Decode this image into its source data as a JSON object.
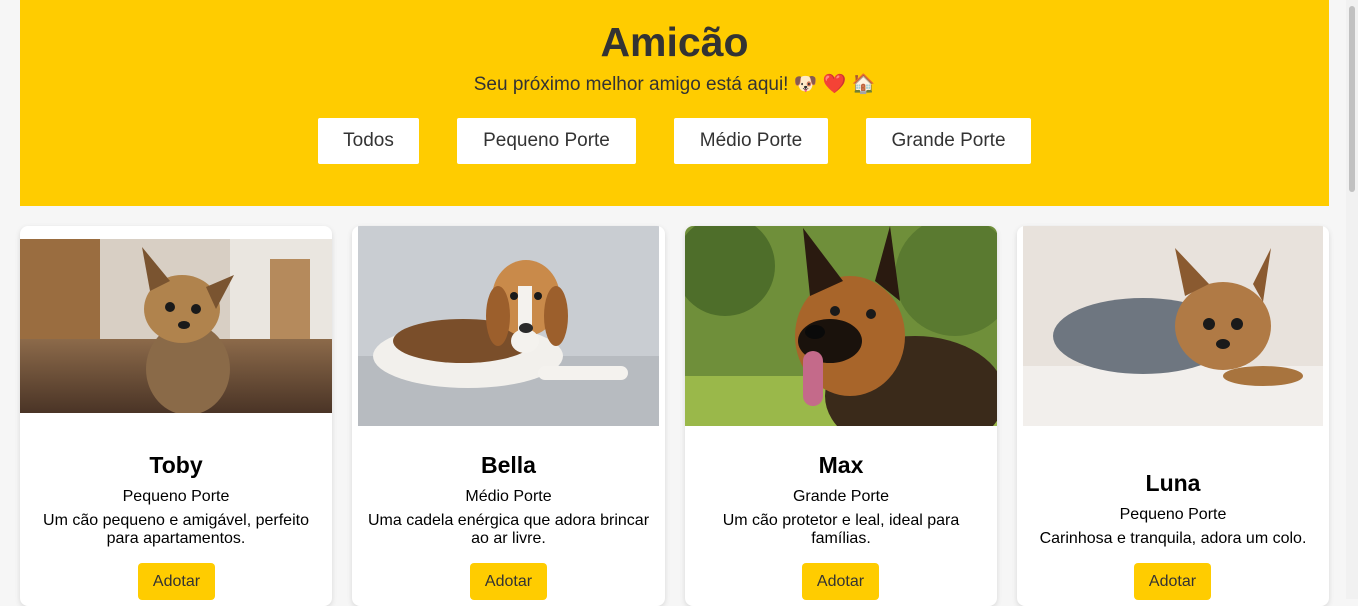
{
  "header": {
    "title": "Amicão",
    "subtitle": "Seu próximo melhor amigo está aqui! 🐶 ❤️ 🏠",
    "filters": [
      "Todos",
      "Pequeno Porte",
      "Médio Porte",
      "Grande Porte"
    ]
  },
  "dogs": [
    {
      "name": "Toby",
      "size": "Pequeno Porte",
      "description": "Um cão pequeno e amigável, perfeito para apartamentos.",
      "button": "Adotar",
      "photo": "yorkshire-terrier-photo"
    },
    {
      "name": "Bella",
      "size": "Médio Porte",
      "description": "Uma cadela enérgica que adora brincar ao ar livre.",
      "button": "Adotar",
      "photo": "beagle-photo"
    },
    {
      "name": "Max",
      "size": "Grande Porte",
      "description": "Um cão protetor e leal, ideal para famílias.",
      "button": "Adotar",
      "photo": "german-shepherd-photo"
    },
    {
      "name": "Luna",
      "size": "Pequeno Porte",
      "description": "Carinhosa e tranquila, adora um colo.",
      "button": "Adotar",
      "photo": "yorkshire-terrier-lying-photo"
    }
  ],
  "colors": {
    "accent": "#ffcc00",
    "text": "#333333"
  }
}
